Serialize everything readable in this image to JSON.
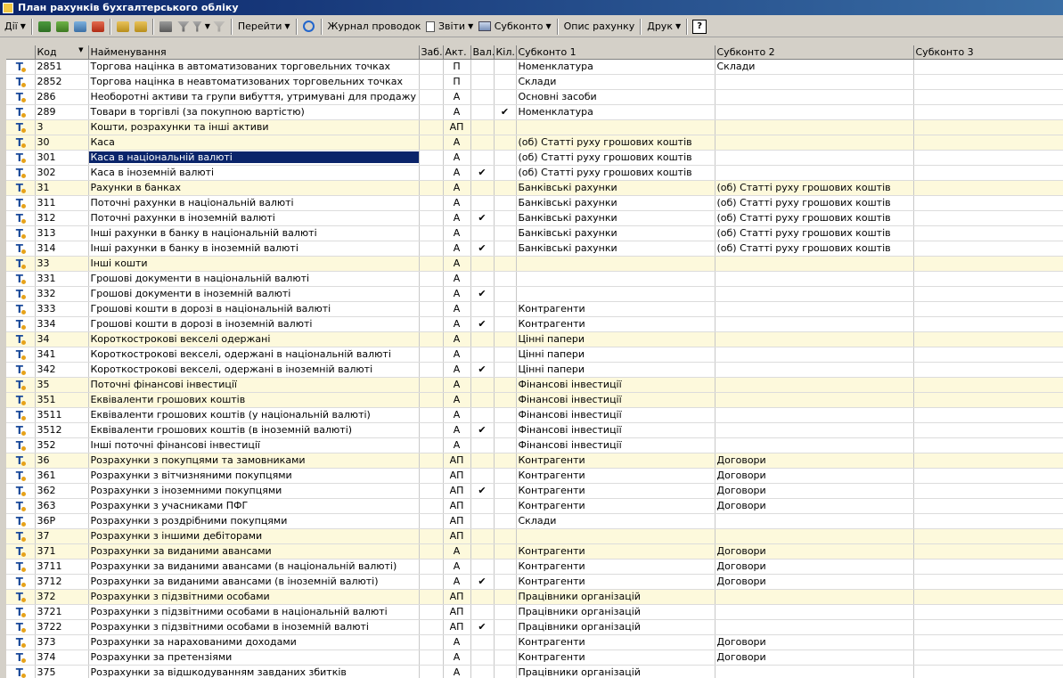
{
  "window": {
    "title": "План рахунків бухгалтерського обліку"
  },
  "toolbar": {
    "actions_label": "Дії",
    "goto_label": "Перейти",
    "journal_label": "Журнал проводок",
    "reports_label": "Звіти",
    "subconto_label": "Субконто",
    "account_desc_label": "Опис рахунку",
    "print_label": "Друк",
    "help_label": "?"
  },
  "table": {
    "headers": {
      "code": "Код",
      "name": "Найменування",
      "off": "Заб.",
      "act": "Акт.",
      "cur": "Вал.",
      "qty": "Кіл.",
      "s1": "Субконто 1",
      "s2": "Субконто 2",
      "s3": "Субконто 3"
    },
    "rows": [
      {
        "code": "2851",
        "name": "Торгова націнка в автоматизованих торговельних точках",
        "act": "П",
        "cur": "",
        "s1": "Номенклатура",
        "s2": "Склади",
        "group": false
      },
      {
        "code": "2852",
        "name": "Торгова націнка в неавтоматизованих торговельних точках",
        "act": "П",
        "cur": "",
        "s1": "Склади",
        "s2": "",
        "group": false
      },
      {
        "code": "286",
        "name": "Необоротні активи та групи вибуття, утримувані для продажу",
        "act": "А",
        "cur": "",
        "s1": "Основні засоби",
        "s2": "",
        "group": false
      },
      {
        "code": "289",
        "name": "Товари в торгівлі (за покупною вартістю)",
        "act": "А",
        "cur": "",
        "qty": "✔",
        "s1": "Номенклатура",
        "s2": "",
        "group": false
      },
      {
        "code": "3",
        "name": "Кошти, розрахунки та інші активи",
        "act": "АП",
        "cur": "",
        "s1": "",
        "s2": "",
        "group": true
      },
      {
        "code": "30",
        "name": "Каса",
        "act": "А",
        "cur": "",
        "s1": "(об) Статті руху грошових коштів",
        "s2": "",
        "group": true
      },
      {
        "code": "301",
        "name": "Каса в національній валюті",
        "act": "А",
        "cur": "",
        "s1": "(об) Статті руху грошових коштів",
        "s2": "",
        "group": false,
        "selected": true
      },
      {
        "code": "302",
        "name": "Каса в іноземній валюті",
        "act": "А",
        "cur": "✔",
        "s1": "(об) Статті руху грошових коштів",
        "s2": "",
        "group": false
      },
      {
        "code": "31",
        "name": "Рахунки в банках",
        "act": "А",
        "cur": "",
        "s1": "Банківські рахунки",
        "s2": "(об) Статті руху грошових коштів",
        "group": true
      },
      {
        "code": "311",
        "name": "Поточні рахунки в національній валюті",
        "act": "А",
        "cur": "",
        "s1": "Банківські рахунки",
        "s2": "(об) Статті руху грошових коштів",
        "group": false
      },
      {
        "code": "312",
        "name": "Поточні рахунки в іноземній валюті",
        "act": "А",
        "cur": "✔",
        "s1": "Банківські рахунки",
        "s2": "(об) Статті руху грошових коштів",
        "group": false
      },
      {
        "code": "313",
        "name": "Інші рахунки в банку в національній валюті",
        "act": "А",
        "cur": "",
        "s1": "Банківські рахунки",
        "s2": "(об) Статті руху грошових коштів",
        "group": false
      },
      {
        "code": "314",
        "name": "Інші рахунки в банку в іноземній валюті",
        "act": "А",
        "cur": "✔",
        "s1": "Банківські рахунки",
        "s2": "(об) Статті руху грошових коштів",
        "group": false
      },
      {
        "code": "33",
        "name": "Інші кошти",
        "act": "А",
        "cur": "",
        "s1": "",
        "s2": "",
        "group": true
      },
      {
        "code": "331",
        "name": "Грошові документи в національній валюті",
        "act": "А",
        "cur": "",
        "s1": "",
        "s2": "",
        "group": false
      },
      {
        "code": "332",
        "name": "Грошові документи в іноземній валюті",
        "act": "А",
        "cur": "✔",
        "s1": "",
        "s2": "",
        "group": false
      },
      {
        "code": "333",
        "name": "Грошові кошти в дорозі в національній валюті",
        "act": "А",
        "cur": "",
        "s1": "Контрагенти",
        "s2": "",
        "group": false
      },
      {
        "code": "334",
        "name": "Грошові кошти в дорозі в іноземній валюті",
        "act": "А",
        "cur": "✔",
        "s1": "Контрагенти",
        "s2": "",
        "group": false
      },
      {
        "code": "34",
        "name": "Короткострокові векселі одержані",
        "act": "А",
        "cur": "",
        "s1": "Цінні папери",
        "s2": "",
        "group": true
      },
      {
        "code": "341",
        "name": "Короткострокові векселі, одержані в національній валюті",
        "act": "А",
        "cur": "",
        "s1": "Цінні папери",
        "s2": "",
        "group": false
      },
      {
        "code": "342",
        "name": "Короткострокові векселі, одержані в іноземній валюті",
        "act": "А",
        "cur": "✔",
        "s1": "Цінні папери",
        "s2": "",
        "group": false
      },
      {
        "code": "35",
        "name": "Поточні фінансові інвестиції",
        "act": "А",
        "cur": "",
        "s1": "Фінансові інвестиції",
        "s2": "",
        "group": true
      },
      {
        "code": "351",
        "name": "Еквіваленти грошових коштів",
        "act": "А",
        "cur": "",
        "s1": "Фінансові інвестиції",
        "s2": "",
        "group": true
      },
      {
        "code": "3511",
        "name": "Еквіваленти грошових коштів (у національній валюті)",
        "act": "А",
        "cur": "",
        "s1": "Фінансові інвестиції",
        "s2": "",
        "group": false
      },
      {
        "code": "3512",
        "name": "Еквіваленти грошових коштів (в іноземній валюті)",
        "act": "А",
        "cur": "✔",
        "s1": "Фінансові інвестиції",
        "s2": "",
        "group": false
      },
      {
        "code": "352",
        "name": "Інші поточні фінансові інвестиції",
        "act": "А",
        "cur": "",
        "s1": "Фінансові інвестиції",
        "s2": "",
        "group": false
      },
      {
        "code": "36",
        "name": "Розрахунки з покупцями та замовниками",
        "act": "АП",
        "cur": "",
        "s1": "Контрагенти",
        "s2": "Договори",
        "group": true
      },
      {
        "code": "361",
        "name": "Розрахунки з вітчизняними покупцями",
        "act": "АП",
        "cur": "",
        "s1": "Контрагенти",
        "s2": "Договори",
        "group": false
      },
      {
        "code": "362",
        "name": "Розрахунки з іноземними покупцями",
        "act": "АП",
        "cur": "✔",
        "s1": "Контрагенти",
        "s2": "Договори",
        "group": false
      },
      {
        "code": "363",
        "name": "Розрахунки з учасниками ПФГ",
        "act": "АП",
        "cur": "",
        "s1": "Контрагенти",
        "s2": "Договори",
        "group": false
      },
      {
        "code": "36Р",
        "name": "Розрахунки з роздрібними покупцями",
        "act": "АП",
        "cur": "",
        "s1": "Склади",
        "s2": "",
        "group": false
      },
      {
        "code": "37",
        "name": "Розрахунки з іншими дебіторами",
        "act": "АП",
        "cur": "",
        "s1": "",
        "s2": "",
        "group": true
      },
      {
        "code": "371",
        "name": "Розрахунки за виданими авансами",
        "act": "А",
        "cur": "",
        "s1": "Контрагенти",
        "s2": "Договори",
        "group": true
      },
      {
        "code": "3711",
        "name": "Розрахунки за виданими авансами (в національній валюті)",
        "act": "А",
        "cur": "",
        "s1": "Контрагенти",
        "s2": "Договори",
        "group": false
      },
      {
        "code": "3712",
        "name": "Розрахунки за виданими авансами (в іноземній валюті)",
        "act": "А",
        "cur": "✔",
        "s1": "Контрагенти",
        "s2": "Договори",
        "group": false
      },
      {
        "code": "372",
        "name": "Розрахунки з підзвітними особами",
        "act": "АП",
        "cur": "",
        "s1": "Працівники організацій",
        "s2": "",
        "group": true
      },
      {
        "code": "3721",
        "name": "Розрахунки з підзвітними особами в національній валюті",
        "act": "АП",
        "cur": "",
        "s1": "Працівники організацій",
        "s2": "",
        "group": false
      },
      {
        "code": "3722",
        "name": "Розрахунки з підзвітними особами в іноземній валюті",
        "act": "АП",
        "cur": "✔",
        "s1": "Працівники організацій",
        "s2": "",
        "group": false
      },
      {
        "code": "373",
        "name": "Розрахунки за нарахованими доходами",
        "act": "А",
        "cur": "",
        "s1": "Контрагенти",
        "s2": "Договори",
        "group": false
      },
      {
        "code": "374",
        "name": "Розрахунки за претензіями",
        "act": "А",
        "cur": "",
        "s1": "Контрагенти",
        "s2": "Договори",
        "group": false
      },
      {
        "code": "375",
        "name": "Розрахунки за відшкодуванням завданих збитків",
        "act": "А",
        "cur": "",
        "s1": "Працівники організацій",
        "s2": "",
        "group": false
      }
    ]
  }
}
